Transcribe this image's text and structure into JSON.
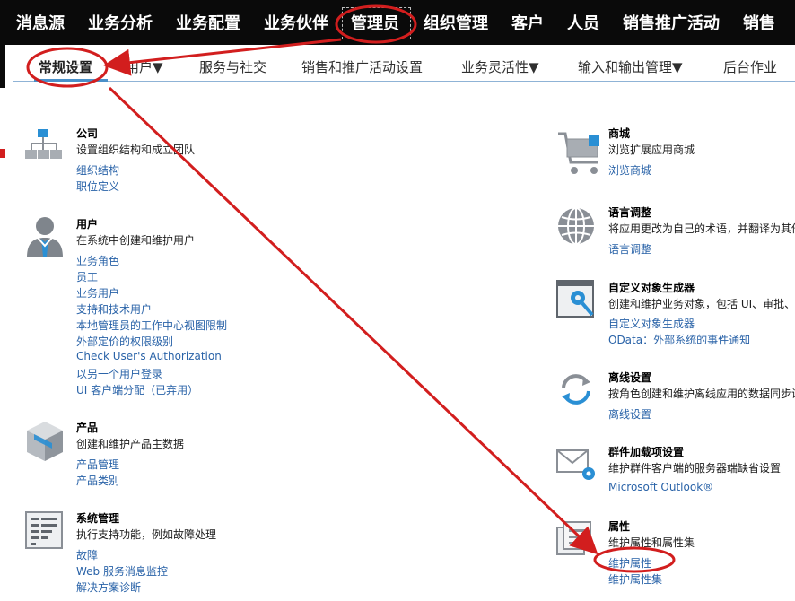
{
  "topnav": {
    "items": [
      "消息源",
      "业务分析",
      "业务配置",
      "业务伙伴",
      "管理员",
      "组织管理",
      "客户",
      "人员",
      "销售推广活动",
      "销售"
    ]
  },
  "subnav": {
    "items": [
      "常规设置",
      "用户▼",
      "服务与社交",
      "销售和推广活动设置",
      "业务灵活性▼",
      "输入和输出管理▼",
      "后台作业"
    ]
  },
  "left_sections": [
    {
      "icon": "org-chart-icon",
      "title": "公司",
      "desc": "设置组织结构和成立团队",
      "links": [
        "组织结构",
        "职位定义"
      ]
    },
    {
      "icon": "user-icon",
      "title": "用户",
      "desc": "在系统中创建和维护用户",
      "links": [
        "业务角色",
        "员工",
        "业务用户",
        "支持和技术用户",
        "本地管理员的工作中心视图限制",
        "外部定价的权限级别",
        "Check User's Authorization",
        "以另一个用户登录",
        "UI 客户端分配（已弃用）"
      ]
    },
    {
      "icon": "product-box-icon",
      "title": "产品",
      "desc": "创建和维护产品主数据",
      "links": [
        "产品管理",
        "产品类别"
      ]
    },
    {
      "icon": "system-monitor-icon",
      "title": "系统管理",
      "desc": "执行支持功能，例如故障处理",
      "links": [
        "故障",
        "Web 服务消息监控",
        "解决方案诊断"
      ]
    }
  ],
  "right_sections": [
    {
      "icon": "shopping-cart-icon",
      "title": "商城",
      "desc": "浏览扩展应用商城",
      "links": [
        "浏览商城"
      ]
    },
    {
      "icon": "globe-icon",
      "title": "语言调整",
      "desc": "将应用更改为自己的术语，并翻译为其他",
      "links": [
        "语言调整"
      ]
    },
    {
      "icon": "custom-object-builder-icon",
      "title": "自定义对象生成器",
      "desc": "创建和维护业务对象，包括 UI、审批、通",
      "links": [
        "自定义对象生成器",
        "OData：外部系统的事件通知"
      ]
    },
    {
      "icon": "offline-sync-icon",
      "title": "离线设置",
      "desc": "按角色创建和维护离线应用的数据同步设",
      "links": [
        "离线设置"
      ]
    },
    {
      "icon": "email-settings-icon",
      "title": "群件加载项设置",
      "desc": "维护群件客户端的服务器端缺省设置",
      "links": [
        "Microsoft Outlook®"
      ]
    },
    {
      "icon": "properties-icon",
      "title": "属性",
      "desc": "维护属性和属性集",
      "links": [
        "维护属性",
        "维护属性集"
      ]
    }
  ],
  "colors": {
    "topbar": "#0a0a0a",
    "link": "#2a63a8",
    "annotation": "#d21e1e",
    "subnav_underline": "#4a90c9"
  }
}
